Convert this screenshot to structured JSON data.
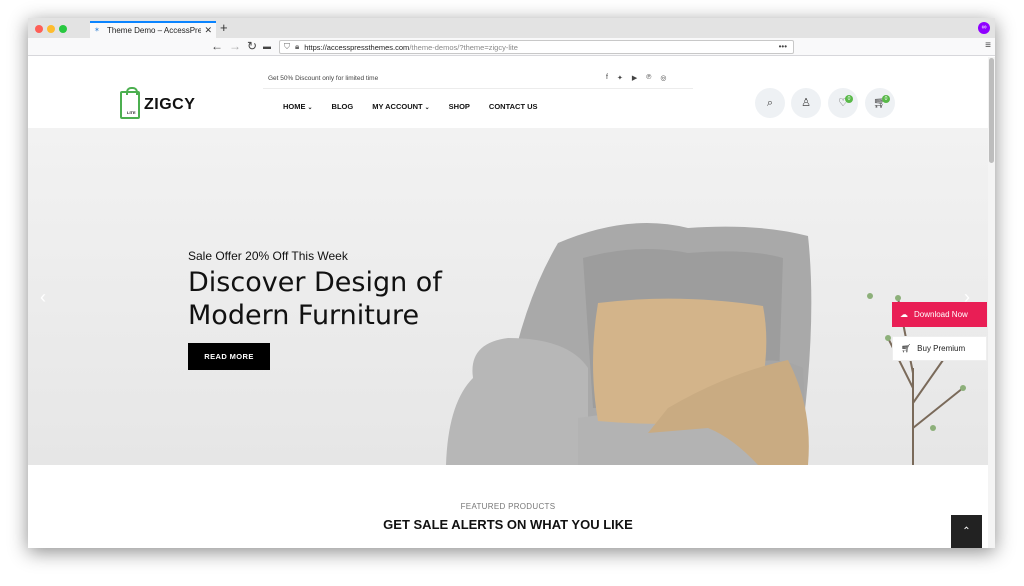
{
  "browser": {
    "tab_title": "Theme Demo – AccessPre",
    "url_host": "https://accesspressthemes.com",
    "url_path": "/theme-demos/?theme=zigcy-lite"
  },
  "header": {
    "topline": "Get 50% Discount only for limited time",
    "logo": "ZIGCY",
    "logo_sub": "LITE",
    "menu": {
      "home": "HOME",
      "blog": "BLOG",
      "account": "MY ACCOUNT",
      "shop": "SHOP",
      "contact": "CONTACT US"
    },
    "wishlist_count": "0",
    "cart_count": "0"
  },
  "hero": {
    "subtitle": "Sale Offer 20% Off This Week",
    "title": "Discover Design of Modern Furniture",
    "button": "READ MORE"
  },
  "side_buttons": {
    "download": "Download Now",
    "premium": "Buy Premium"
  },
  "featured": {
    "label": "FEATURED PRODUCTS",
    "heading": "GET SALE ALERTS ON WHAT YOU LIKE"
  },
  "colors": {
    "accent_green": "#59b949",
    "download_pink": "#e91e55"
  }
}
